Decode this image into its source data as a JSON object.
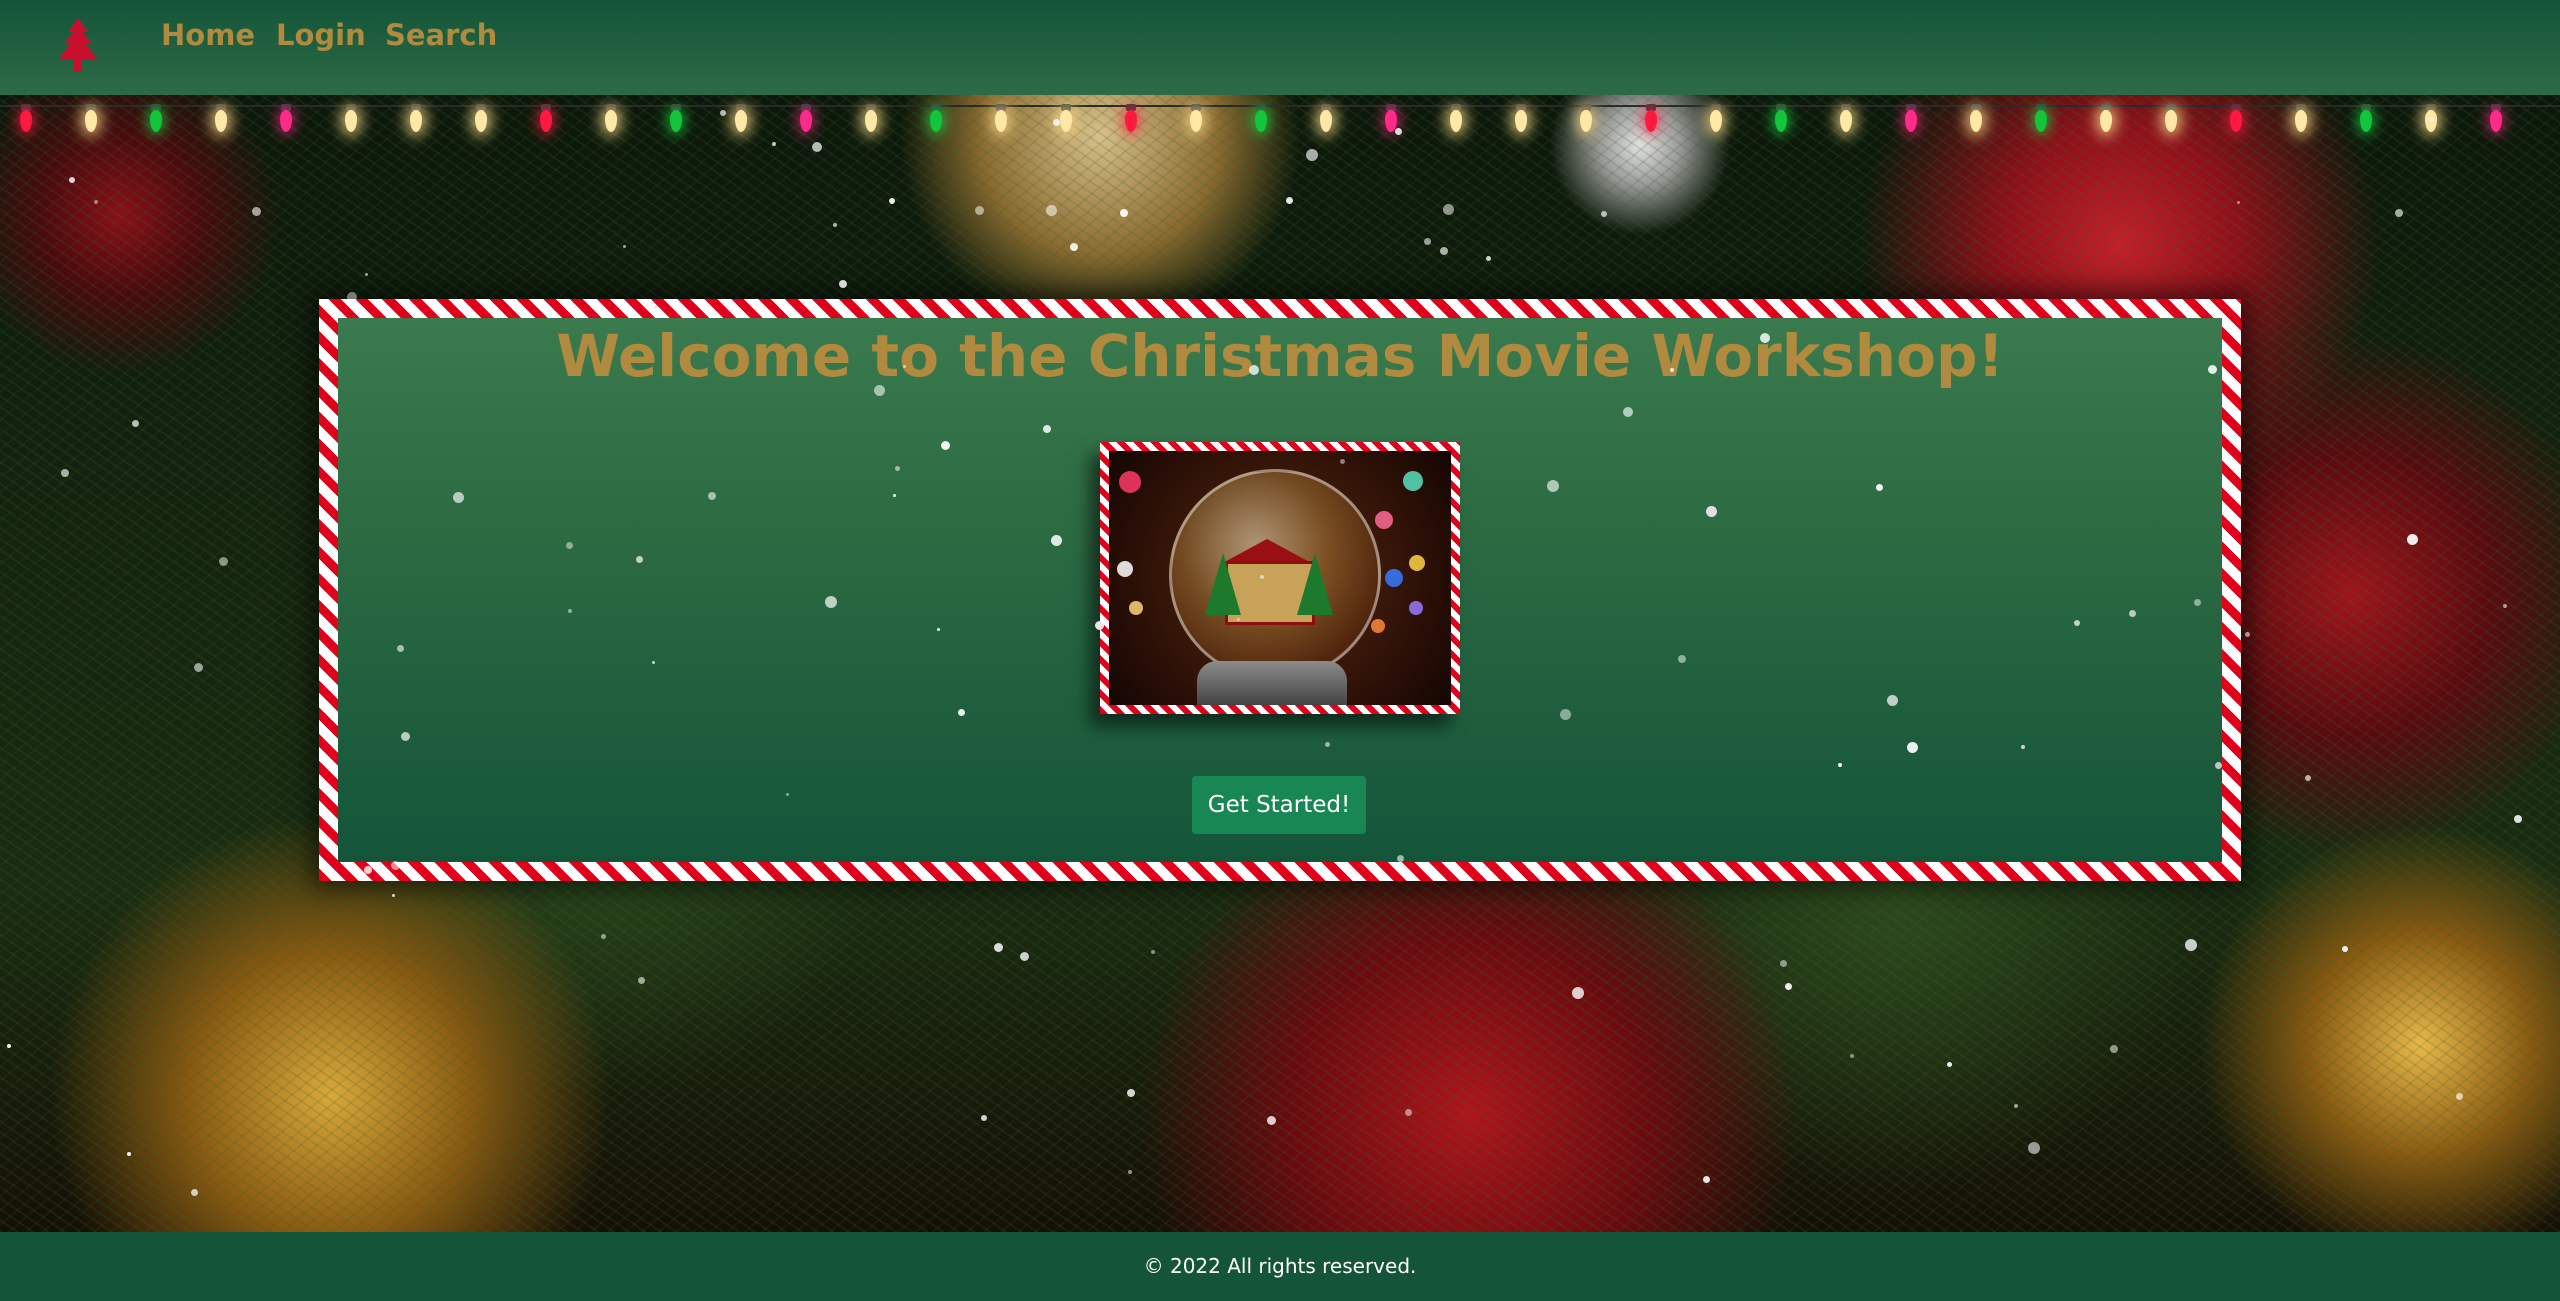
{
  "nav": {
    "brand_icon": "christmas-tree-icon",
    "links": [
      "Home",
      "Login",
      "Search"
    ]
  },
  "hero": {
    "title": "Welcome to the Christmas Movie Workshop!",
    "image_icon": "snow-globe-image",
    "cta_label": "Get Started!"
  },
  "footer": {
    "text": "© 2022 All rights reserved."
  },
  "colors": {
    "navbar": "#14553a",
    "link_gold": "#b08a3e",
    "candy_red": "#e0001b",
    "button_green": "#198754",
    "footer": "#14553a"
  }
}
